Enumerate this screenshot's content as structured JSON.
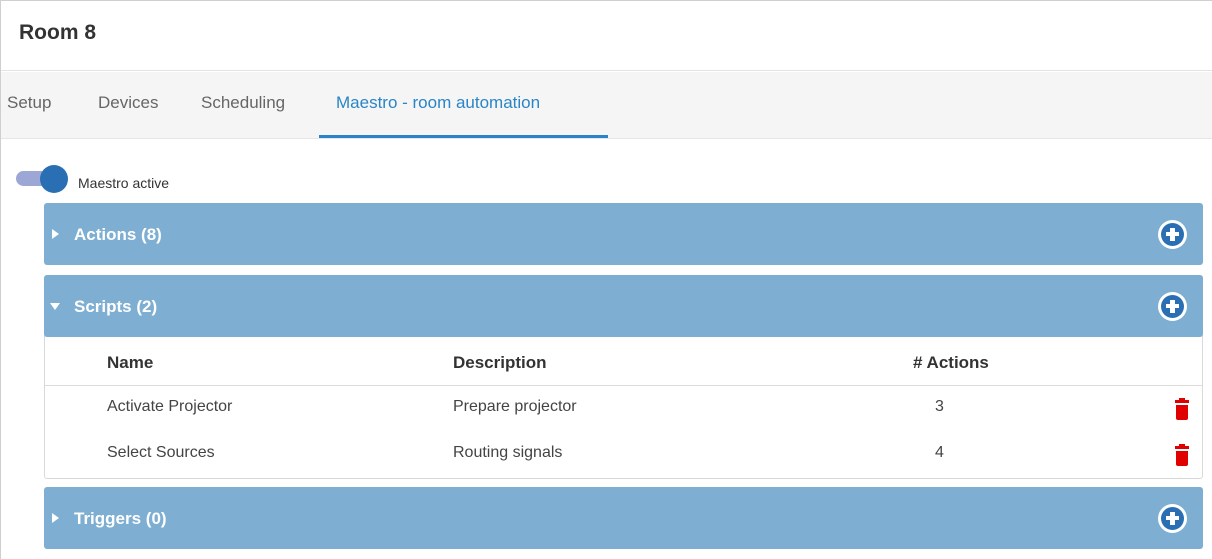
{
  "window": {
    "title": "Room 8"
  },
  "tabs": [
    {
      "label": "Setup",
      "active": false
    },
    {
      "label": "Devices",
      "active": false
    },
    {
      "label": "Scheduling",
      "active": false
    },
    {
      "label": "Maestro - room automation",
      "active": true
    }
  ],
  "maestro": {
    "toggle_label": "Maestro active",
    "active": true
  },
  "panels": {
    "actions": {
      "title": "Actions (8)",
      "expanded": false
    },
    "scripts": {
      "title": "Scripts (2)",
      "expanded": true,
      "columns": [
        "Name",
        "Description",
        "# Actions"
      ],
      "rows": [
        {
          "name": "Activate Projector",
          "description": "Prepare projector",
          "actions": "3"
        },
        {
          "name": "Select Sources",
          "description": "Routing signals",
          "actions": "4"
        }
      ]
    },
    "triggers": {
      "title": "Triggers (0)",
      "expanded": false
    }
  },
  "colors": {
    "panel_header": "#7eafd2",
    "accent": "#2a85c6",
    "add_button": "#2a6fb4",
    "delete_icon": "#e00000",
    "toggle_track": "#9da7d6"
  },
  "icons": {
    "add": "plus-circle-icon",
    "delete": "trash-icon",
    "collapsed": "caret-right-icon",
    "expanded": "caret-down-icon"
  }
}
